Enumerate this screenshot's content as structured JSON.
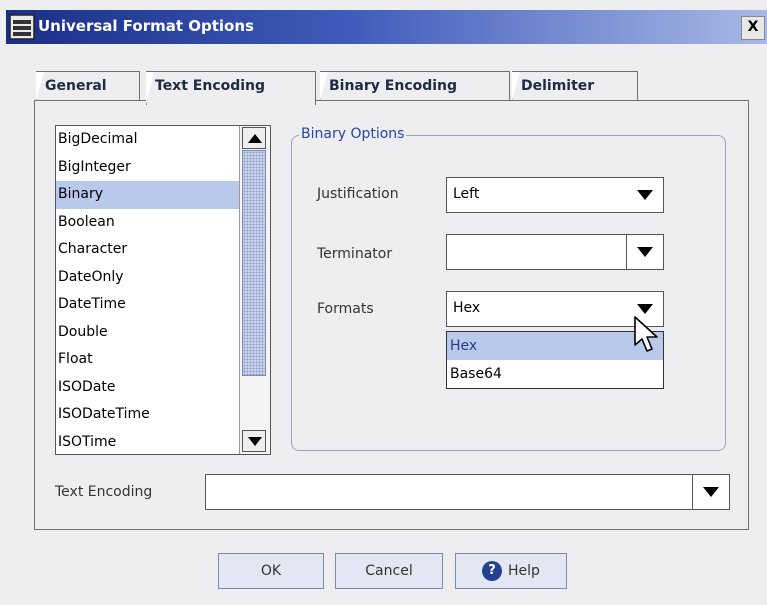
{
  "window": {
    "title": "Universal Format Options",
    "close_label": "X"
  },
  "tabs": [
    {
      "label": "General",
      "selected": false
    },
    {
      "label": "Text Encoding",
      "selected": true
    },
    {
      "label": "Binary Encoding",
      "selected": false
    },
    {
      "label": "Delimiter",
      "selected": false
    }
  ],
  "type_list": {
    "items": [
      "BigDecimal",
      "BigInteger",
      "Binary",
      "Boolean",
      "Character",
      "DateOnly",
      "DateTime",
      "Double",
      "Float",
      "ISODate",
      "ISODateTime",
      "ISOTime"
    ],
    "selected": "Binary"
  },
  "binary_options": {
    "title": "Binary Options",
    "justification": {
      "label": "Justification",
      "value": "Left"
    },
    "terminator": {
      "label": "Terminator",
      "value": ""
    },
    "formats": {
      "label": "Formats",
      "value": "Hex",
      "options": [
        "Hex",
        "Base64"
      ]
    }
  },
  "text_encoding": {
    "label": "Text Encoding",
    "value": ""
  },
  "buttons": {
    "ok": "OK",
    "cancel": "Cancel",
    "help": "Help"
  },
  "colors": {
    "title_start": "#1a2f86",
    "selection": "#b9c9ec",
    "group_title": "#2346a8"
  }
}
